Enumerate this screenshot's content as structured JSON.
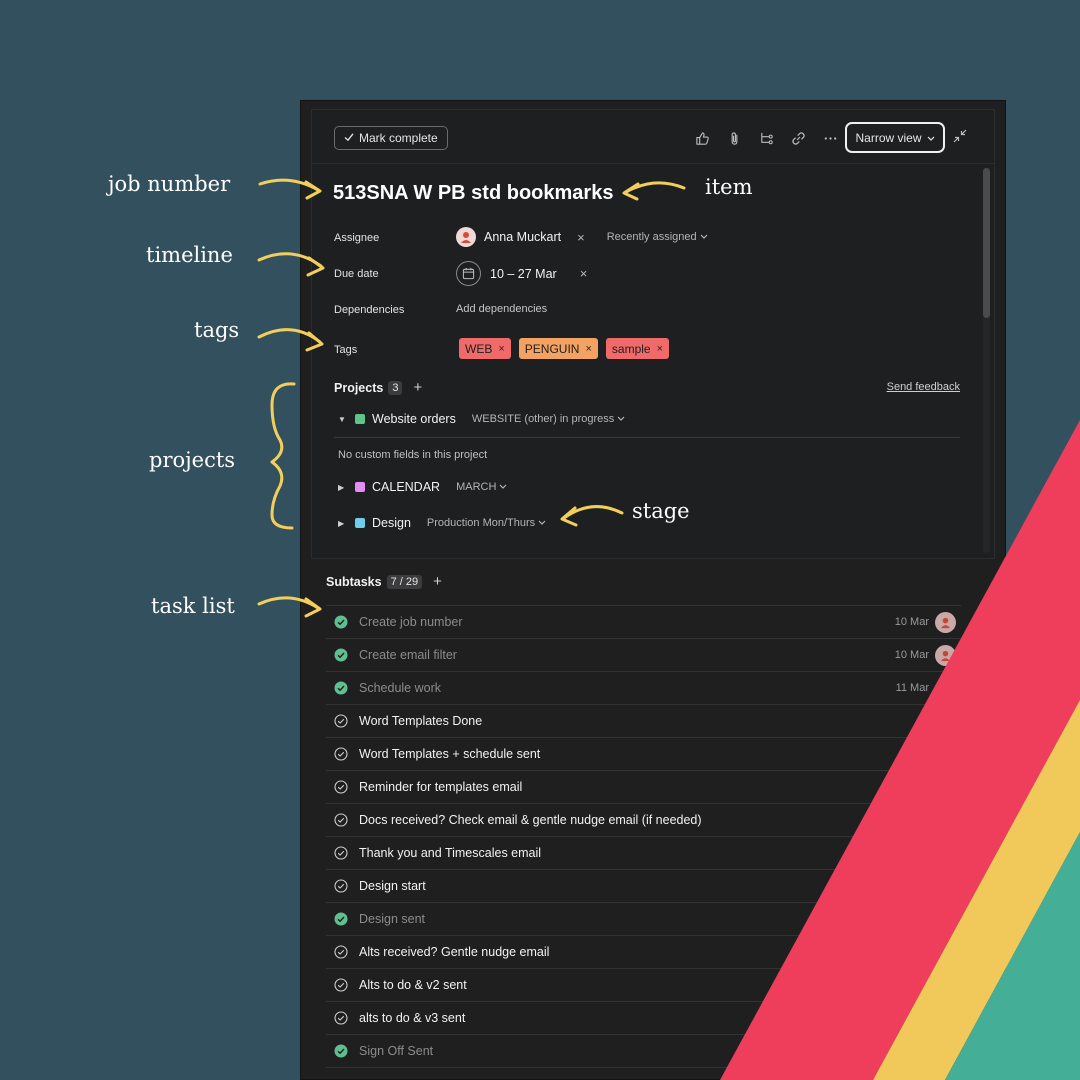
{
  "annotations": {
    "job_number": "job number",
    "item": "item",
    "timeline": "timeline",
    "tags": "tags",
    "projects": "projects",
    "stage": "stage",
    "task_list": "task list"
  },
  "toolbar": {
    "mark_complete": "Mark complete",
    "narrow_view": "Narrow view",
    "icons": [
      "thumbs-up-icon",
      "paperclip-icon",
      "subtask-icon",
      "link-icon",
      "more-icon"
    ]
  },
  "task": {
    "title": "513SNA W PB std bookmarks"
  },
  "fields": {
    "assignee_label": "Assignee",
    "assignee_name": "Anna Muckart",
    "assignee_remove": "×",
    "recently_assigned": "Recently assigned",
    "due_label": "Due date",
    "due_value": "10 – 27 Mar",
    "due_remove": "×",
    "dependencies_label": "Dependencies",
    "add_dependencies": "Add dependencies",
    "tags_label": "Tags"
  },
  "tags": [
    {
      "label": "WEB",
      "remove": "×",
      "color": "#f06a6a"
    },
    {
      "label": "PENGUIN",
      "remove": "×",
      "color": "#f4a261"
    },
    {
      "label": "sample",
      "remove": "×",
      "color": "#f06a6a"
    }
  ],
  "projects": {
    "label": "Projects",
    "count": "3",
    "add": "+",
    "send_feedback": "Send feedback",
    "no_custom_fields": "No custom fields in this project",
    "items": [
      {
        "name": "Website orders",
        "stage": "WEBSITE (other) in progress",
        "color": "#5fc48a",
        "expander": "▼"
      },
      {
        "name": "CALENDAR",
        "stage": "MARCH",
        "color": "#e38ef0",
        "expander": "▶"
      },
      {
        "name": "Design",
        "stage": "Production Mon/Thurs",
        "color": "#6fcde8",
        "expander": "▶"
      }
    ]
  },
  "subtasks": {
    "label": "Subtasks",
    "count": "7 / 29",
    "add": "+",
    "items": [
      {
        "text": "Create job number",
        "done": true,
        "date": "10 Mar",
        "avatar": true
      },
      {
        "text": "Create email filter",
        "done": true,
        "date": "10 Mar",
        "avatar": true
      },
      {
        "text": "Schedule work",
        "done": true,
        "date": "11 Mar",
        "avatar": false
      },
      {
        "text": "Word Templates Done",
        "done": false,
        "date": "",
        "avatar": false
      },
      {
        "text": "Word Templates + schedule sent",
        "done": false,
        "date": "",
        "avatar": false
      },
      {
        "text": "Reminder for templates email",
        "done": false,
        "date": "",
        "avatar": false
      },
      {
        "text": "Docs received? Check email & gentle nudge email (if needed)",
        "done": false,
        "date": "",
        "avatar": false
      },
      {
        "text": "Thank you and Timescales email",
        "done": false,
        "date": "",
        "avatar": false
      },
      {
        "text": "Design start",
        "done": false,
        "date": "",
        "avatar": false
      },
      {
        "text": "Design sent",
        "done": true,
        "date": "",
        "avatar": false
      },
      {
        "text": "Alts received? Gentle nudge email",
        "done": false,
        "date": "",
        "avatar": false
      },
      {
        "text": "Alts to do & v2 sent",
        "done": false,
        "date": "",
        "avatar": false
      },
      {
        "text": "alts to do & v3 sent",
        "done": false,
        "date": "",
        "avatar": false
      },
      {
        "text": "Sign Off Sent",
        "done": true,
        "date": "",
        "avatar": false
      }
    ]
  },
  "colors": {
    "background": "#33505f",
    "panel": "#1f1f20",
    "stripe_red": "#ef3e5c",
    "stripe_yellow": "#f0c95a",
    "stripe_teal": "#44ae97",
    "annotation_arrow": "#f2cf5b",
    "check_done": "#5fbf8f"
  }
}
